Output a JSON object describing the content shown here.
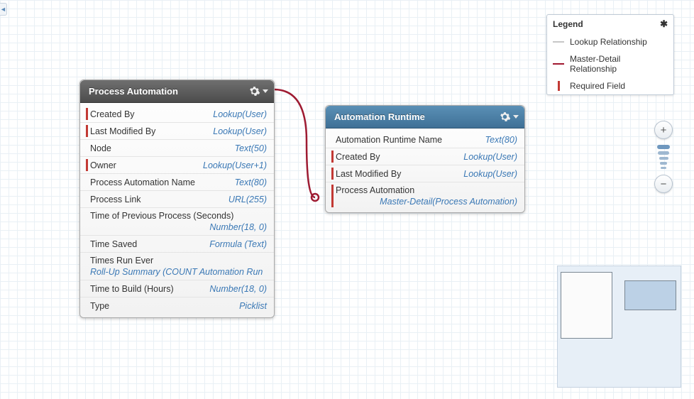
{
  "sideTab": "◄",
  "entities": {
    "pa": {
      "title": "Process Automation",
      "fields": [
        {
          "label": "Created By",
          "type": "Lookup(User)",
          "required": true
        },
        {
          "label": "Last Modified By",
          "type": "Lookup(User)",
          "required": true
        },
        {
          "label": "Node",
          "type": "Text(50)",
          "required": false
        },
        {
          "label": "Owner",
          "type": "Lookup(User+1)",
          "required": true
        },
        {
          "label": "Process Automation Name",
          "type": "Text(80)",
          "required": false
        },
        {
          "label": "Process Link",
          "type": "URL(255)",
          "required": false
        },
        {
          "label": "Time of Previous Process (Seconds)",
          "type": "Number(18, 0)",
          "required": false,
          "stacked": true
        },
        {
          "label": "Time Saved",
          "type": "Formula (Text)",
          "required": false
        },
        {
          "label": "Times Run Ever",
          "type": "Roll-Up Summary (COUNT Automation Run",
          "required": false,
          "stacked": true,
          "stackedLeft": true
        },
        {
          "label": "Time to Build (Hours)",
          "type": "Number(18, 0)",
          "required": false
        },
        {
          "label": "Type",
          "type": "Picklist",
          "required": false
        }
      ]
    },
    "ar": {
      "title": "Automation Runtime",
      "fields": [
        {
          "label": "Automation Runtime Name",
          "type": "Text(80)",
          "required": false
        },
        {
          "label": "Created By",
          "type": "Lookup(User)",
          "required": true
        },
        {
          "label": "Last Modified By",
          "type": "Lookup(User)",
          "required": true
        },
        {
          "label": "Process Automation",
          "type": "Master-Detail(Process Automation)",
          "required": true,
          "stacked": true
        }
      ]
    }
  },
  "legend": {
    "title": "Legend",
    "items": [
      {
        "label": "Lookup Relationship"
      },
      {
        "label": "Master-Detail Relationship"
      },
      {
        "label": "Required Field"
      }
    ]
  },
  "zoom": {
    "in": "+",
    "out": "−"
  }
}
